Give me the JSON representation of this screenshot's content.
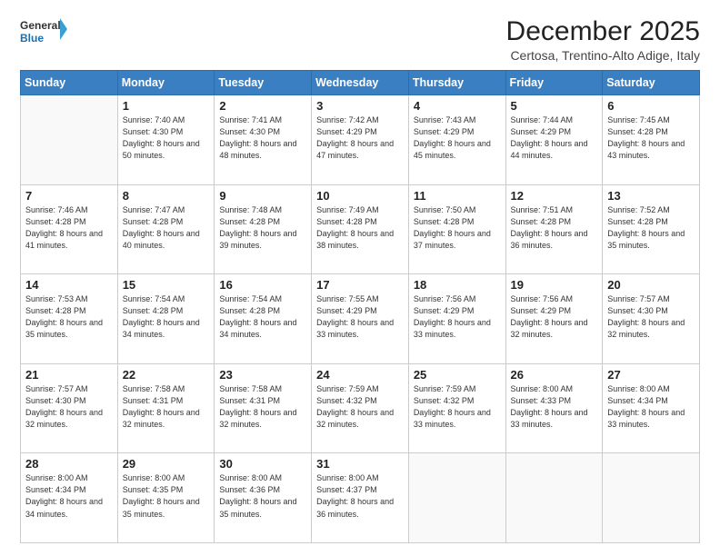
{
  "logo": {
    "line1": "General",
    "line2": "Blue"
  },
  "title": "December 2025",
  "subtitle": "Certosa, Trentino-Alto Adige, Italy",
  "days_header": [
    "Sunday",
    "Monday",
    "Tuesday",
    "Wednesday",
    "Thursday",
    "Friday",
    "Saturday"
  ],
  "weeks": [
    [
      {
        "day": "",
        "info": ""
      },
      {
        "day": "1",
        "info": "Sunrise: 7:40 AM\nSunset: 4:30 PM\nDaylight: 8 hours\nand 50 minutes."
      },
      {
        "day": "2",
        "info": "Sunrise: 7:41 AM\nSunset: 4:30 PM\nDaylight: 8 hours\nand 48 minutes."
      },
      {
        "day": "3",
        "info": "Sunrise: 7:42 AM\nSunset: 4:29 PM\nDaylight: 8 hours\nand 47 minutes."
      },
      {
        "day": "4",
        "info": "Sunrise: 7:43 AM\nSunset: 4:29 PM\nDaylight: 8 hours\nand 45 minutes."
      },
      {
        "day": "5",
        "info": "Sunrise: 7:44 AM\nSunset: 4:29 PM\nDaylight: 8 hours\nand 44 minutes."
      },
      {
        "day": "6",
        "info": "Sunrise: 7:45 AM\nSunset: 4:28 PM\nDaylight: 8 hours\nand 43 minutes."
      }
    ],
    [
      {
        "day": "7",
        "info": "Sunrise: 7:46 AM\nSunset: 4:28 PM\nDaylight: 8 hours\nand 41 minutes."
      },
      {
        "day": "8",
        "info": "Sunrise: 7:47 AM\nSunset: 4:28 PM\nDaylight: 8 hours\nand 40 minutes."
      },
      {
        "day": "9",
        "info": "Sunrise: 7:48 AM\nSunset: 4:28 PM\nDaylight: 8 hours\nand 39 minutes."
      },
      {
        "day": "10",
        "info": "Sunrise: 7:49 AM\nSunset: 4:28 PM\nDaylight: 8 hours\nand 38 minutes."
      },
      {
        "day": "11",
        "info": "Sunrise: 7:50 AM\nSunset: 4:28 PM\nDaylight: 8 hours\nand 37 minutes."
      },
      {
        "day": "12",
        "info": "Sunrise: 7:51 AM\nSunset: 4:28 PM\nDaylight: 8 hours\nand 36 minutes."
      },
      {
        "day": "13",
        "info": "Sunrise: 7:52 AM\nSunset: 4:28 PM\nDaylight: 8 hours\nand 35 minutes."
      }
    ],
    [
      {
        "day": "14",
        "info": "Sunrise: 7:53 AM\nSunset: 4:28 PM\nDaylight: 8 hours\nand 35 minutes."
      },
      {
        "day": "15",
        "info": "Sunrise: 7:54 AM\nSunset: 4:28 PM\nDaylight: 8 hours\nand 34 minutes."
      },
      {
        "day": "16",
        "info": "Sunrise: 7:54 AM\nSunset: 4:28 PM\nDaylight: 8 hours\nand 34 minutes."
      },
      {
        "day": "17",
        "info": "Sunrise: 7:55 AM\nSunset: 4:29 PM\nDaylight: 8 hours\nand 33 minutes."
      },
      {
        "day": "18",
        "info": "Sunrise: 7:56 AM\nSunset: 4:29 PM\nDaylight: 8 hours\nand 33 minutes."
      },
      {
        "day": "19",
        "info": "Sunrise: 7:56 AM\nSunset: 4:29 PM\nDaylight: 8 hours\nand 32 minutes."
      },
      {
        "day": "20",
        "info": "Sunrise: 7:57 AM\nSunset: 4:30 PM\nDaylight: 8 hours\nand 32 minutes."
      }
    ],
    [
      {
        "day": "21",
        "info": "Sunrise: 7:57 AM\nSunset: 4:30 PM\nDaylight: 8 hours\nand 32 minutes."
      },
      {
        "day": "22",
        "info": "Sunrise: 7:58 AM\nSunset: 4:31 PM\nDaylight: 8 hours\nand 32 minutes."
      },
      {
        "day": "23",
        "info": "Sunrise: 7:58 AM\nSunset: 4:31 PM\nDaylight: 8 hours\nand 32 minutes."
      },
      {
        "day": "24",
        "info": "Sunrise: 7:59 AM\nSunset: 4:32 PM\nDaylight: 8 hours\nand 32 minutes."
      },
      {
        "day": "25",
        "info": "Sunrise: 7:59 AM\nSunset: 4:32 PM\nDaylight: 8 hours\nand 33 minutes."
      },
      {
        "day": "26",
        "info": "Sunrise: 8:00 AM\nSunset: 4:33 PM\nDaylight: 8 hours\nand 33 minutes."
      },
      {
        "day": "27",
        "info": "Sunrise: 8:00 AM\nSunset: 4:34 PM\nDaylight: 8 hours\nand 33 minutes."
      }
    ],
    [
      {
        "day": "28",
        "info": "Sunrise: 8:00 AM\nSunset: 4:34 PM\nDaylight: 8 hours\nand 34 minutes."
      },
      {
        "day": "29",
        "info": "Sunrise: 8:00 AM\nSunset: 4:35 PM\nDaylight: 8 hours\nand 35 minutes."
      },
      {
        "day": "30",
        "info": "Sunrise: 8:00 AM\nSunset: 4:36 PM\nDaylight: 8 hours\nand 35 minutes."
      },
      {
        "day": "31",
        "info": "Sunrise: 8:00 AM\nSunset: 4:37 PM\nDaylight: 8 hours\nand 36 minutes."
      },
      {
        "day": "",
        "info": ""
      },
      {
        "day": "",
        "info": ""
      },
      {
        "day": "",
        "info": ""
      }
    ]
  ]
}
